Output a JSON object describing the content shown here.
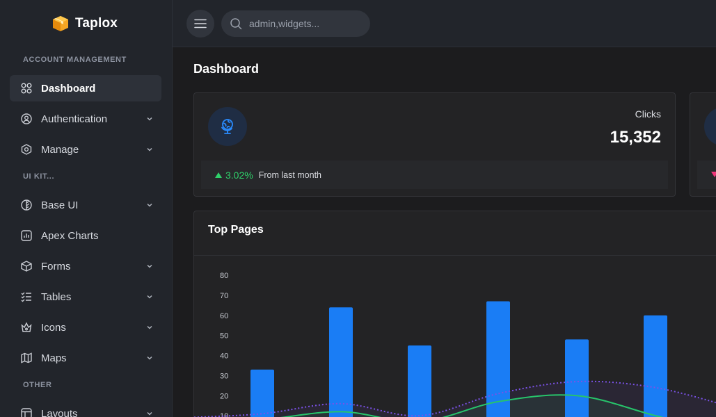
{
  "brand": {
    "name": "Taplox"
  },
  "sidebar": {
    "sections": {
      "account": "ACCOUNT MANAGEMENT",
      "uikit": "UI KIT...",
      "other": "OTHER"
    },
    "items": [
      {
        "label": "Dashboard",
        "icon": "grid-icon",
        "active": true,
        "has_submenu": false
      },
      {
        "label": "Authentication",
        "icon": "user-circle-icon",
        "active": false,
        "has_submenu": true
      },
      {
        "label": "Manage",
        "icon": "hexagon-icon",
        "active": false,
        "has_submenu": true
      },
      {
        "label": "Base UI",
        "icon": "leaf-icon",
        "active": false,
        "has_submenu": true
      },
      {
        "label": "Apex Charts",
        "icon": "bar-chart-icon",
        "active": false,
        "has_submenu": false
      },
      {
        "label": "Forms",
        "icon": "box-icon",
        "active": false,
        "has_submenu": true
      },
      {
        "label": "Tables",
        "icon": "checklist-icon",
        "active": false,
        "has_submenu": true
      },
      {
        "label": "Icons",
        "icon": "crown-icon",
        "active": false,
        "has_submenu": true
      },
      {
        "label": "Maps",
        "icon": "map-icon",
        "active": false,
        "has_submenu": true
      },
      {
        "label": "Layouts",
        "icon": "layout-icon",
        "active": false,
        "has_submenu": true
      }
    ]
  },
  "topbar": {
    "search_placeholder": "admin,widgets..."
  },
  "page": {
    "title": "Dashboard"
  },
  "stats": {
    "clicks": {
      "label": "Clicks",
      "value": "15,352",
      "change": "3.02%",
      "change_label": "From last month"
    }
  },
  "colors": {
    "accent": "#1a7df5",
    "positive": "#2fd06a",
    "negative": "#f0367a",
    "line_green": "#27c46b",
    "line_purple": "#7b52e8"
  },
  "chart_data": {
    "type": "bar",
    "title": "Top Pages",
    "ylim": [
      0,
      80
    ],
    "yticks": [
      10,
      20,
      30,
      40,
      50,
      60,
      70,
      80
    ],
    "grid": false,
    "series": [
      {
        "type": "bar",
        "values": [
          33,
          64,
          45,
          67,
          48,
          60
        ]
      },
      {
        "type": "line",
        "style": "solid",
        "values": [
          8,
          12,
          7,
          17,
          20,
          10
        ]
      },
      {
        "type": "line",
        "style": "dotted",
        "values": [
          11,
          16,
          10,
          21,
          27,
          24
        ]
      }
    ]
  }
}
